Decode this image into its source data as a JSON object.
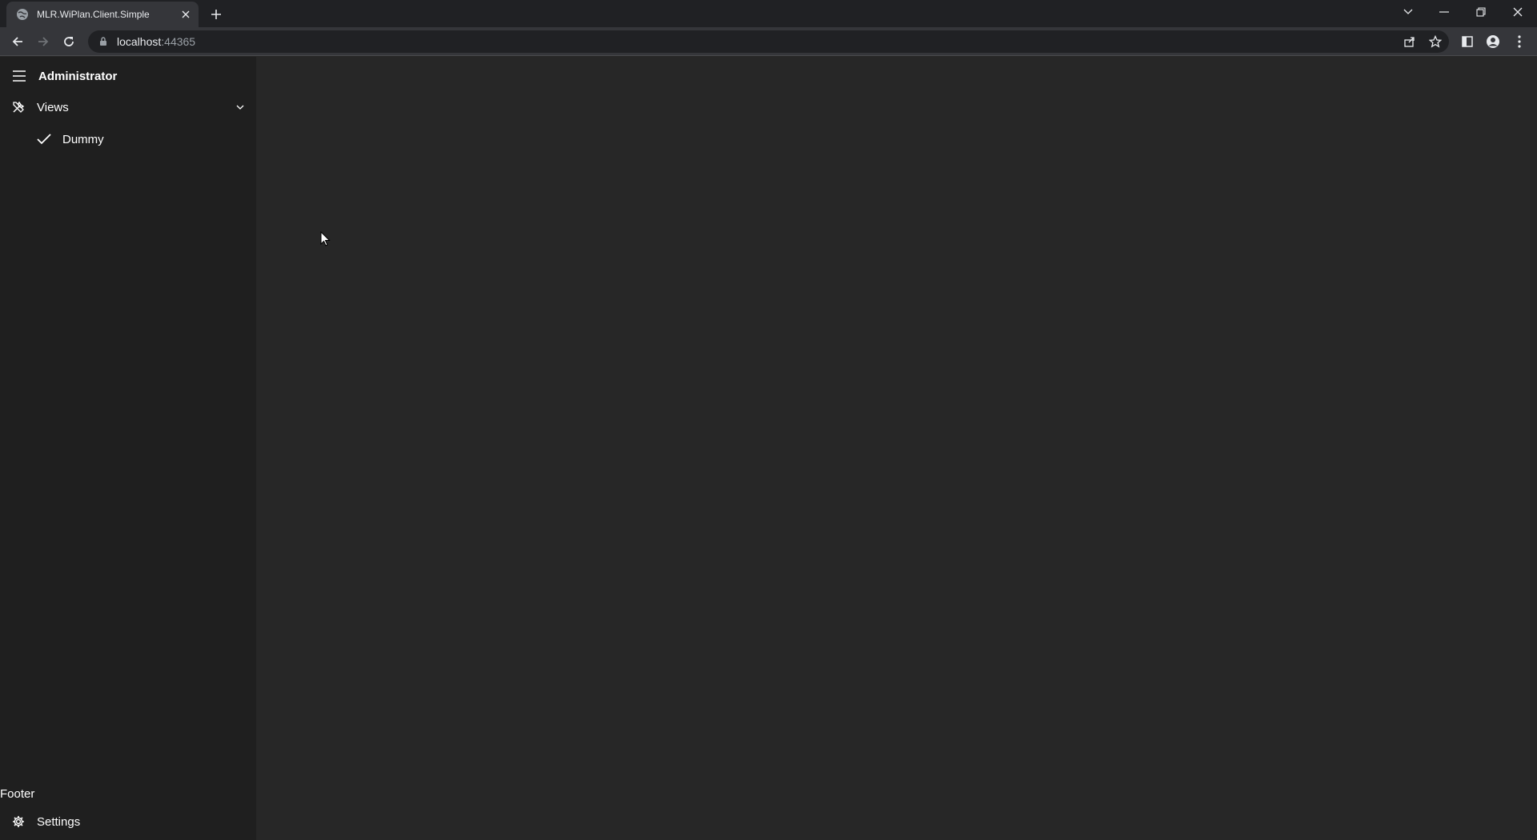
{
  "browser": {
    "tab": {
      "title": "MLR.WiPlan.Client.Simple"
    },
    "address": {
      "host": "localhost",
      "port": ":44365"
    }
  },
  "app": {
    "sidebar": {
      "title": "Administrator",
      "nav": [
        {
          "label": "Views",
          "icon": "tools-icon",
          "expanded": true
        },
        {
          "label": "Dummy",
          "icon": "check-icon"
        }
      ],
      "footer_text": "Footer",
      "settings_label": "Settings"
    }
  },
  "colors": {
    "sidebar_bg": "#1f1f1f",
    "main_bg": "#272727",
    "chrome_bg": "#202124",
    "toolbar_bg": "#35363a"
  }
}
